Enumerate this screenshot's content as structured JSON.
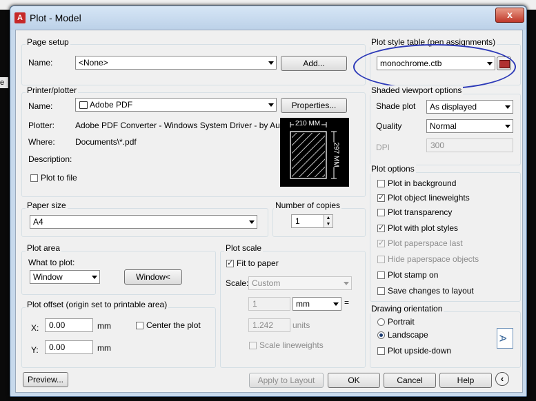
{
  "window": {
    "title": "Plot - Model",
    "close_glyph": "x",
    "app_icon_letter": "A"
  },
  "background": {
    "side_text": "e"
  },
  "page_setup": {
    "group_title": "Page setup",
    "name_label": "Name:",
    "name_value": "<None>",
    "add_button": "Add..."
  },
  "plot_style_table": {
    "group_title": "Plot style table (pen assignments)",
    "value": "monochrome.ctb"
  },
  "printer": {
    "group_title": "Printer/plotter",
    "name_label": "Name:",
    "name_value": "Adobe PDF",
    "properties_button": "Properties...",
    "plotter_label": "Plotter:",
    "plotter_value": "Adobe PDF Converter - Windows System Driver - by Au...",
    "where_label": "Where:",
    "where_value": "Documents\\*.pdf",
    "description_label": "Description:",
    "plot_to_file": "Plot to file",
    "paper_width": "210 MM",
    "paper_height": "297 MM"
  },
  "shaded_viewport": {
    "group_title": "Shaded viewport options",
    "shade_label": "Shade plot",
    "shade_value": "As displayed",
    "quality_label": "Quality",
    "quality_value": "Normal",
    "dpi_label": "DPI",
    "dpi_value": "300"
  },
  "paper_size": {
    "group_title": "Paper size",
    "value": "A4"
  },
  "copies": {
    "group_title": "Number of copies",
    "value": "1"
  },
  "plot_options": {
    "group_title": "Plot options",
    "items": [
      {
        "label": "Plot in background",
        "checked": false,
        "disabled": false
      },
      {
        "label": "Plot object lineweights",
        "checked": true,
        "disabled": false
      },
      {
        "label": "Plot transparency",
        "checked": false,
        "disabled": false
      },
      {
        "label": "Plot with plot styles",
        "checked": true,
        "disabled": false
      },
      {
        "label": "Plot paperspace last",
        "checked": true,
        "disabled": true
      },
      {
        "label": "Hide paperspace objects",
        "checked": false,
        "disabled": true
      },
      {
        "label": "Plot stamp on",
        "checked": false,
        "disabled": false
      },
      {
        "label": "Save changes to layout",
        "checked": false,
        "disabled": false
      }
    ]
  },
  "plot_area": {
    "group_title": "Plot area",
    "what_label": "What to plot:",
    "what_value": "Window",
    "window_button": "Window<"
  },
  "plot_scale": {
    "group_title": "Plot scale",
    "fit_label": "Fit to paper",
    "scale_label": "Scale:",
    "scale_value": "Custom",
    "value1": "1",
    "unit_value": "mm",
    "equals": "=",
    "value2": "1.242",
    "units_label": "units",
    "scale_lineweights": "Scale lineweights"
  },
  "plot_offset": {
    "group_title": "Plot offset (origin set to printable area)",
    "x_label": "X:",
    "x_value": "0.00",
    "x_unit": "mm",
    "y_label": "Y:",
    "y_value": "0.00",
    "y_unit": "mm",
    "center_label": "Center the plot"
  },
  "orientation": {
    "group_title": "Drawing orientation",
    "portrait": "Portrait",
    "landscape": "Landscape",
    "upside_down": "Plot upside-down",
    "icon_letter": "A"
  },
  "footer": {
    "preview": "Preview...",
    "apply": "Apply to Layout",
    "ok": "OK",
    "cancel": "Cancel",
    "help": "Help"
  },
  "colors": {
    "annotation": "#2d3ab8",
    "title_bar": "#c7d9ec",
    "close": "#c0382a"
  }
}
